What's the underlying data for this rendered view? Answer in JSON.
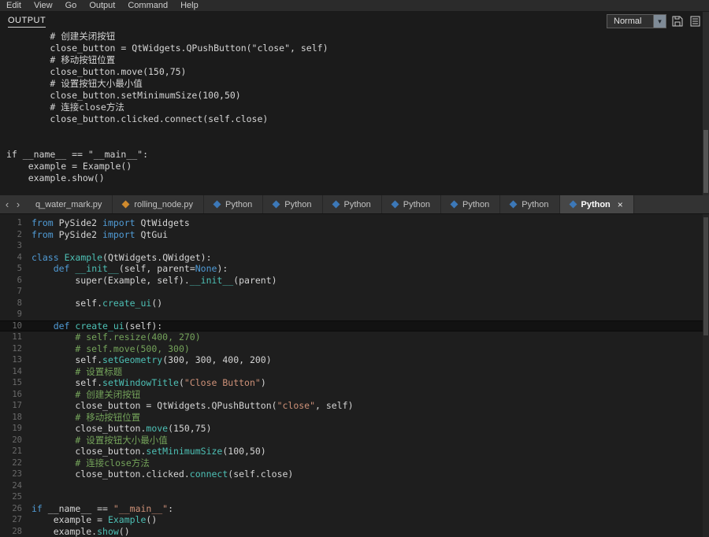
{
  "menu": {
    "items": [
      "Edit",
      "View",
      "Go",
      "Output",
      "Command",
      "Help"
    ]
  },
  "output": {
    "label": "OUTPUT",
    "mode": "Normal",
    "dropdown_arrow": "▾",
    "lines": [
      "        # 创建关闭按钮",
      "        close_button = QtWidgets.QPushButton(\"close\", self)",
      "        # 移动按钮位置",
      "        close_button.move(150,75)",
      "        # 设置按钮大小最小值",
      "        close_button.setMinimumSize(100,50)",
      "        # 连接close方法",
      "        close_button.clicked.connect(self.close)",
      "",
      "",
      "if __name__ == \"__main__\":",
      "    example = Example()",
      "    example.show()"
    ]
  },
  "tab_bar": {
    "left_arrow": "‹",
    "right_arrow": "›",
    "close_glyph": "×",
    "python_icon_color": "#3c78b8",
    "tabs": [
      {
        "label": "q_water_mark.py",
        "icon": "",
        "active": false,
        "closable": false
      },
      {
        "label": "rolling_node.py",
        "icon": "#cf8a2d",
        "active": false,
        "closable": false
      },
      {
        "label": "Python",
        "icon": "#3c78b8",
        "active": false,
        "closable": false
      },
      {
        "label": "Python",
        "icon": "#3c78b8",
        "active": false,
        "closable": false
      },
      {
        "label": "Python",
        "icon": "#3c78b8",
        "active": false,
        "closable": false
      },
      {
        "label": "Python",
        "icon": "#3c78b8",
        "active": false,
        "closable": false
      },
      {
        "label": "Python",
        "icon": "#3c78b8",
        "active": false,
        "closable": false
      },
      {
        "label": "Python",
        "icon": "#3c78b8",
        "active": false,
        "closable": false
      },
      {
        "label": "Python",
        "icon": "#3c78b8",
        "active": true,
        "closable": true
      }
    ]
  },
  "editor": {
    "current_line": 10,
    "lines": [
      [
        [
          "kw",
          "from"
        ],
        [
          "p",
          " PySide2 "
        ],
        [
          "kw",
          "import"
        ],
        [
          "p",
          " QtWidgets"
        ]
      ],
      [
        [
          "kw",
          "from"
        ],
        [
          "p",
          " PySide2 "
        ],
        [
          "kw",
          "import"
        ],
        [
          "p",
          " QtGui"
        ]
      ],
      [],
      [
        [
          "kw",
          "class"
        ],
        [
          "p",
          " "
        ],
        [
          "fn",
          "Example"
        ],
        [
          "p",
          "(QtWidgets.QWidget):"
        ]
      ],
      [
        [
          "p",
          "    "
        ],
        [
          "kw",
          "def"
        ],
        [
          "p",
          " "
        ],
        [
          "fn",
          "__init__"
        ],
        [
          "p",
          "(self, parent="
        ],
        [
          "kw",
          "None"
        ],
        [
          "p",
          "):"
        ]
      ],
      [
        [
          "p",
          "        super(Example, self)."
        ],
        [
          "fn",
          "__init__"
        ],
        [
          "p",
          "(parent)"
        ]
      ],
      [],
      [
        [
          "p",
          "        self."
        ],
        [
          "fn",
          "create_ui"
        ],
        [
          "p",
          "()"
        ]
      ],
      [],
      [
        [
          "p",
          "    "
        ],
        [
          "kw",
          "def"
        ],
        [
          "p",
          " "
        ],
        [
          "fn",
          "create_ui"
        ],
        [
          "p",
          "(self):"
        ]
      ],
      [
        [
          "p",
          "        "
        ],
        [
          "com",
          "# self.resize(400, 270)"
        ]
      ],
      [
        [
          "p",
          "        "
        ],
        [
          "com",
          "# self.move(500, 300)"
        ]
      ],
      [
        [
          "p",
          "        self."
        ],
        [
          "fn",
          "setGeometry"
        ],
        [
          "p",
          "(300, 300, 400, 200)"
        ]
      ],
      [
        [
          "p",
          "        "
        ],
        [
          "com",
          "# 设置标题"
        ]
      ],
      [
        [
          "p",
          "        self."
        ],
        [
          "fn",
          "setWindowTitle"
        ],
        [
          "p",
          "("
        ],
        [
          "str",
          "\"Close Button\""
        ],
        [
          "p",
          ")"
        ]
      ],
      [
        [
          "p",
          "        "
        ],
        [
          "com",
          "# 创建关闭按钮"
        ]
      ],
      [
        [
          "p",
          "        close_button = QtWidgets.QPushButton("
        ],
        [
          "str",
          "\"close\""
        ],
        [
          "p",
          ", self)"
        ]
      ],
      [
        [
          "p",
          "        "
        ],
        [
          "com",
          "# 移动按钮位置"
        ]
      ],
      [
        [
          "p",
          "        close_button."
        ],
        [
          "fn",
          "move"
        ],
        [
          "p",
          "(150,75)"
        ]
      ],
      [
        [
          "p",
          "        "
        ],
        [
          "com",
          "# 设置按钮大小最小值"
        ]
      ],
      [
        [
          "p",
          "        close_button."
        ],
        [
          "fn",
          "setMinimumSize"
        ],
        [
          "p",
          "(100,50)"
        ]
      ],
      [
        [
          "p",
          "        "
        ],
        [
          "com",
          "# 连接close方法"
        ]
      ],
      [
        [
          "p",
          "        close_button.clicked."
        ],
        [
          "fn",
          "connect"
        ],
        [
          "p",
          "(self.close)"
        ]
      ],
      [],
      [],
      [
        [
          "kw",
          "if"
        ],
        [
          "p",
          " __name__ == "
        ],
        [
          "str",
          "\"__main__\""
        ],
        [
          "p",
          ":"
        ]
      ],
      [
        [
          "p",
          "    example = "
        ],
        [
          "fn",
          "Example"
        ],
        [
          "p",
          "()"
        ]
      ],
      [
        [
          "p",
          "    example."
        ],
        [
          "fn",
          "show"
        ],
        [
          "p",
          "()"
        ]
      ]
    ]
  }
}
